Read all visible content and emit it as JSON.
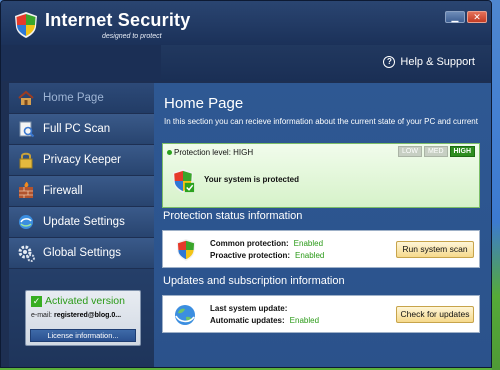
{
  "window": {
    "title": "Internet Security",
    "subtitle": "designed to protect",
    "controls": {
      "minimize": "▁",
      "close": "✕"
    }
  },
  "help": {
    "label": "Help & Support",
    "icon": "?"
  },
  "sidebar": {
    "items": [
      {
        "label": "Home Page",
        "icon": "home-icon",
        "active": true
      },
      {
        "label": "Full PC Scan",
        "icon": "scan-icon"
      },
      {
        "label": "Privacy Keeper",
        "icon": "lock-icon"
      },
      {
        "label": "Firewall",
        "icon": "firewall-icon"
      },
      {
        "label": "Update Settings",
        "icon": "update-icon"
      },
      {
        "label": "Global Settings",
        "icon": "gear-icon"
      }
    ]
  },
  "license": {
    "status": "Activated version",
    "email_label": "e-mail:",
    "email_value": "registered@blog.0...",
    "button": "License information..."
  },
  "main": {
    "title": "Home Page",
    "description": "In this section you can recieve information about the current state of your PC and current",
    "protection": {
      "label": "Protection level: HIGH",
      "levels": [
        "LOW",
        "MED",
        "HIGH"
      ],
      "message": "Your system is protected"
    },
    "status_section": {
      "heading": "Protection status information",
      "rows": [
        {
          "label": "Common protection:",
          "value": "Enabled"
        },
        {
          "label": "Proactive protection:",
          "value": "Enabled"
        }
      ],
      "button": "Run system scan"
    },
    "updates_section": {
      "heading": "Updates and subscription information",
      "rows": [
        {
          "label": "Last system update:",
          "value": ""
        },
        {
          "label": "Automatic updates:",
          "value": "Enabled"
        }
      ],
      "button": "Check for updates"
    }
  },
  "colors": {
    "accent_green": "#2a9a17",
    "window_dark": "#1d2f52",
    "panel_blue": "#2e5893"
  }
}
